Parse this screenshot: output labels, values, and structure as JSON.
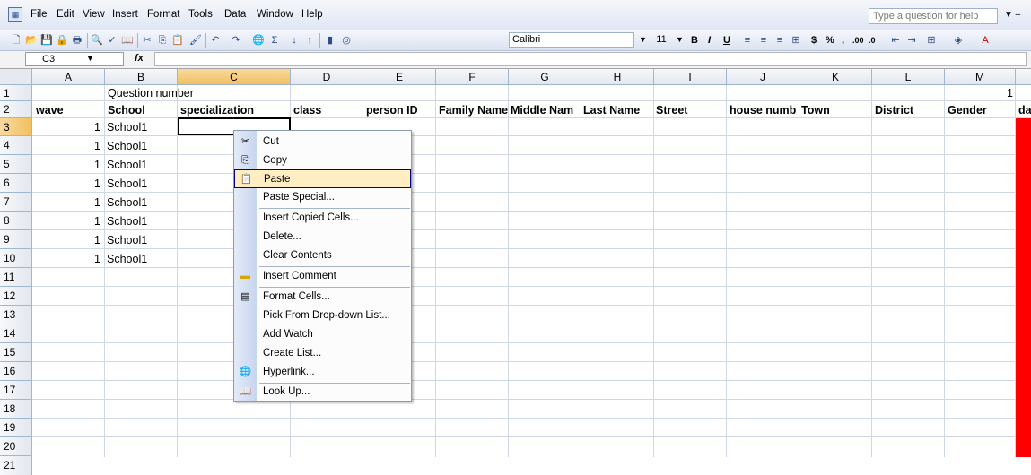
{
  "menubar": {
    "app_icon": "excel-document-icon",
    "items": [
      "File",
      "Edit",
      "View",
      "Insert",
      "Format",
      "Tools",
      "Data",
      "Window",
      "Help"
    ],
    "question_placeholder": "Type a question for help"
  },
  "toolbar": {
    "font_name": "Calibri",
    "font_size": "11",
    "format_buttons": [
      "B",
      "I",
      "U"
    ],
    "icons": [
      "new-icon",
      "open-icon",
      "save-icon",
      "permission-icon",
      "print-icon",
      "print-preview-icon",
      "spelling-icon",
      "research-icon",
      "cut-icon",
      "copy-icon",
      "paste-icon",
      "format-painter-icon",
      "undo-icon",
      "redo-icon",
      "hyperlink-icon",
      "autosum-icon",
      "sort-ascending-icon",
      "sort-descending-icon",
      "chart-icon",
      "help-icon"
    ],
    "extra_symbols": [
      "$",
      "%",
      ",",
      ".00",
      ".0"
    ]
  },
  "formula_bar": {
    "name_box": "C3",
    "fx_label": "fx",
    "formula": ""
  },
  "sheet": {
    "columns": [
      "A",
      "B",
      "C",
      "D",
      "E",
      "F",
      "G",
      "H",
      "I",
      "J",
      "K",
      "L",
      "M"
    ],
    "rows": [
      "1",
      "2",
      "3",
      "4",
      "5",
      "6",
      "7",
      "8",
      "9",
      "10",
      "11",
      "12",
      "13",
      "14",
      "15",
      "16",
      "17",
      "18",
      "19",
      "20",
      "21"
    ],
    "row1": {
      "B": "Question number",
      "M": "1"
    },
    "headers": [
      "wave",
      "School",
      "specialization",
      "class",
      "person ID",
      "Family Name",
      "Middle Nam",
      "Last Name",
      "Street",
      "house numb",
      "Town",
      "District",
      "Gender",
      "da"
    ],
    "data_rows": [
      {
        "wave": "1",
        "school": "School1"
      },
      {
        "wave": "1",
        "school": "School1"
      },
      {
        "wave": "1",
        "school": "School1"
      },
      {
        "wave": "1",
        "school": "School1"
      },
      {
        "wave": "1",
        "school": "School1"
      },
      {
        "wave": "1",
        "school": "School1"
      },
      {
        "wave": "1",
        "school": "School1"
      },
      {
        "wave": "1",
        "school": "School1"
      }
    ],
    "fill_color": "#ff0000"
  },
  "context_menu": {
    "items": [
      {
        "label": "Cut",
        "icon": "scissors-icon"
      },
      {
        "label": "Copy",
        "icon": "copy-icon"
      },
      {
        "label": "Paste",
        "icon": "paste-icon"
      },
      {
        "label": "Paste Special...",
        "icon": ""
      },
      {
        "label": "Insert Copied Cells...",
        "icon": ""
      },
      {
        "label": "Delete...",
        "icon": ""
      },
      {
        "label": "Clear Contents",
        "icon": ""
      },
      {
        "label": "Insert Comment",
        "icon": "comment-icon"
      },
      {
        "label": "Format Cells...",
        "icon": "format-cells-icon"
      },
      {
        "label": "Pick From Drop-down List...",
        "icon": ""
      },
      {
        "label": "Add Watch",
        "icon": ""
      },
      {
        "label": "Create List...",
        "icon": ""
      },
      {
        "label": "Hyperlink...",
        "icon": "hyperlink-icon"
      },
      {
        "label": "Look Up...",
        "icon": "research-icon"
      }
    ],
    "highlighted": "Paste"
  }
}
